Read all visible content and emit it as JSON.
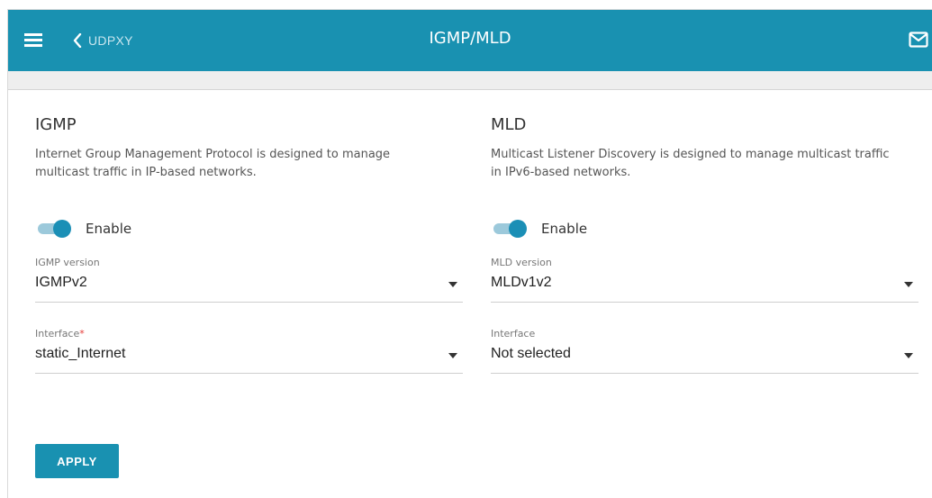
{
  "header": {
    "back_label": "UDPXY",
    "title": "IGMP/MLD",
    "menu_icon": "hamburger-menu-icon",
    "back_icon": "chevron-left-icon",
    "mail_icon": "envelope-icon"
  },
  "igmp": {
    "heading": "IGMP",
    "description_line1": "Internet Group Management Protocol is designed to manage",
    "description_line2": "multicast traffic in IP-based networks.",
    "enable_label": "Enable",
    "enabled": true,
    "version_label": "IGMP version",
    "version_value": "IGMPv2",
    "interface_label": "Interface",
    "interface_required_mark": "*",
    "interface_value": "static_Internet"
  },
  "mld": {
    "heading": "MLD",
    "description_line1": "Multicast Listener Discovery is designed to manage multicast traffic",
    "description_line2": "in IPv6-based networks.",
    "enable_label": "Enable",
    "enabled": true,
    "version_label": "MLD version",
    "version_value": "MLDv1v2",
    "interface_label": "Interface",
    "interface_value": "Not selected"
  },
  "actions": {
    "apply_label": "APPLY"
  },
  "colors": {
    "brand": "#1991b1",
    "toggle_on": "#1b8fb6",
    "toggle_track": "#9cc9db",
    "required": "#e53935"
  }
}
